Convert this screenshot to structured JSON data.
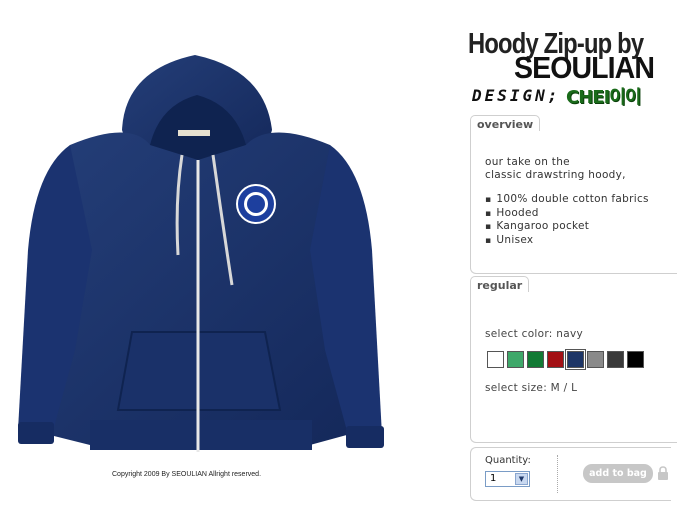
{
  "product": {
    "title_line1": "Hoody Zip-up by",
    "title_line2": "SEOULIAN",
    "design_label": "DESIGN;",
    "designer_name": "CHEI이이",
    "image_alt": "navy-hoodie-photo",
    "copyright": "Copyright 2009 By SEOULIAN Allright reserved."
  },
  "overview": {
    "tab_label": "overview",
    "intro_line1": "our take on the",
    "intro_line2": "classic drawstring hoody,",
    "features": [
      "100% double cotton fabrics",
      "Hooded",
      "Kangaroo pocket",
      "Unisex"
    ]
  },
  "options": {
    "tab_label": "regular",
    "select_color_label": "select color: navy",
    "colors": [
      {
        "name": "white",
        "hex": "#ffffff"
      },
      {
        "name": "light-green",
        "hex": "#3fa86a"
      },
      {
        "name": "green",
        "hex": "#127a34"
      },
      {
        "name": "red",
        "hex": "#a31014"
      },
      {
        "name": "navy",
        "hex": "#1d3566",
        "selected": true
      },
      {
        "name": "gray",
        "hex": "#8a8a8a"
      },
      {
        "name": "charcoal",
        "hex": "#3a3a3a"
      },
      {
        "name": "black",
        "hex": "#000000"
      }
    ],
    "select_size_label": "select size: M / L"
  },
  "purchase": {
    "quantity_label": "Quantity:",
    "quantity_value": "1",
    "add_button_label": "add to bag"
  }
}
